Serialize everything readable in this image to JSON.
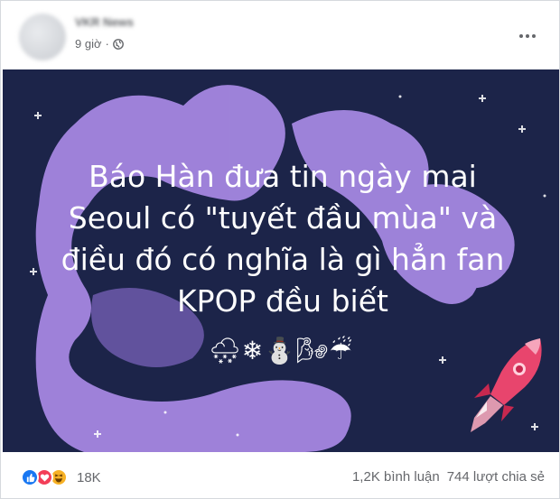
{
  "post": {
    "author": "VKR News",
    "time": "9 giờ",
    "separator": "·",
    "privacy_icon": "globe-icon",
    "more_icon": "more-options-icon"
  },
  "image": {
    "headline_lines": [
      "Báo Hàn đưa tin ngày mai",
      "Seoul có \"tuyết đầu mùa\" và",
      "điều đó có nghĩa là gì hẳn fan",
      "KPOP đều biết"
    ],
    "emojis": "🌨❄⛄🌬☔",
    "colors": {
      "background": "#1c2449",
      "blob": "#a98ae6",
      "text": "#ffffff",
      "rocket": "#e8456d"
    }
  },
  "footer": {
    "reaction_icons": [
      "like-icon",
      "love-icon",
      "haha-icon"
    ],
    "reaction_count": "18K",
    "comments": "1,2K bình luận",
    "shares": "744 lượt chia sẻ"
  }
}
